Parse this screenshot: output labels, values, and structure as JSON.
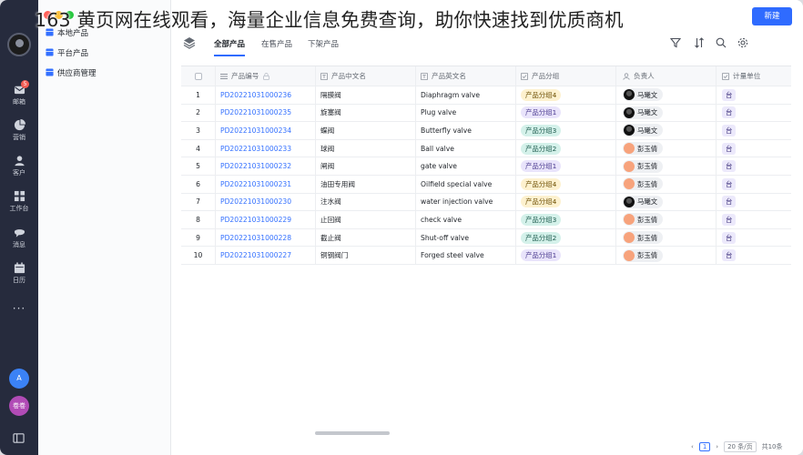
{
  "overlay": {
    "headline": "163 黄页网在线观看，海量企业信息免费查询，助你快速找到优质商机"
  },
  "rail": {
    "items": [
      {
        "label": "邮箱",
        "badge": "5"
      },
      {
        "label": "营销"
      },
      {
        "label": "客户"
      },
      {
        "label": "工作台"
      },
      {
        "label": "消息"
      },
      {
        "label": "日历"
      }
    ],
    "more": "···",
    "avatar_a": "A",
    "avatar_b": "卷卷"
  },
  "subnav": {
    "items": [
      {
        "label": "本地产品"
      },
      {
        "label": "平台产品"
      },
      {
        "label": "供应商管理"
      }
    ]
  },
  "toolbar": {
    "tabs": [
      "全部产品",
      "在售产品",
      "下架产品"
    ],
    "new_button": "新建"
  },
  "table": {
    "headers": {
      "code": "产品编号",
      "cn_name": "产品中文名",
      "en_name": "产品英文名",
      "group": "产品分组",
      "owner": "负责人",
      "unit": "计量单位"
    },
    "rows": [
      {
        "no": "1",
        "code": "PD20221031000236",
        "cn": "隔膜阀",
        "en": "Diaphragm valve",
        "group": "产品分组4",
        "owner": "马曦文",
        "unit": "台"
      },
      {
        "no": "2",
        "code": "PD20221031000235",
        "cn": "旋塞阀",
        "en": "Plug valve",
        "group": "产品分组1",
        "owner": "马曦文",
        "unit": "台"
      },
      {
        "no": "3",
        "code": "PD20221031000234",
        "cn": "蝶阀",
        "en": "Butterfly valve",
        "group": "产品分组3",
        "owner": "马曦文",
        "unit": "台"
      },
      {
        "no": "4",
        "code": "PD20221031000233",
        "cn": "球阀",
        "en": "Ball valve",
        "group": "产品分组2",
        "owner": "彭玉倩",
        "unit": "台"
      },
      {
        "no": "5",
        "code": "PD20221031000232",
        "cn": "闸阀",
        "en": "gate valve",
        "group": "产品分组1",
        "owner": "彭玉倩",
        "unit": "台"
      },
      {
        "no": "6",
        "code": "PD20221031000231",
        "cn": "油田专用阀",
        "en": "Oilfield special valve",
        "group": "产品分组4",
        "owner": "彭玉倩",
        "unit": "台"
      },
      {
        "no": "7",
        "code": "PD20221031000230",
        "cn": "注水阀",
        "en": "water injection valve",
        "group": "产品分组4",
        "owner": "马曦文",
        "unit": "台"
      },
      {
        "no": "8",
        "code": "PD20221031000229",
        "cn": "止回阀",
        "en": "check valve",
        "group": "产品分组3",
        "owner": "彭玉倩",
        "unit": "台"
      },
      {
        "no": "9",
        "code": "PD20221031000228",
        "cn": "截止阀",
        "en": "Shut-off valve",
        "group": "产品分组2",
        "owner": "彭玉倩",
        "unit": "台"
      },
      {
        "no": "10",
        "code": "PD20221031000227",
        "cn": "铜钢阀门",
        "en": "Forged steel valve",
        "group": "产品分组1",
        "owner": "彭玉倩",
        "unit": "台"
      }
    ]
  },
  "pager": {
    "page": "1",
    "page_size": "20 条/页",
    "total": "共10条"
  },
  "colors": {
    "accent": "#2f6bff",
    "rail_bg": "#262b3d",
    "group_tags": {
      "产品分组1": "purple",
      "产品分组2": "teal",
      "产品分组3": "teal",
      "产品分组4": "yellow"
    }
  }
}
